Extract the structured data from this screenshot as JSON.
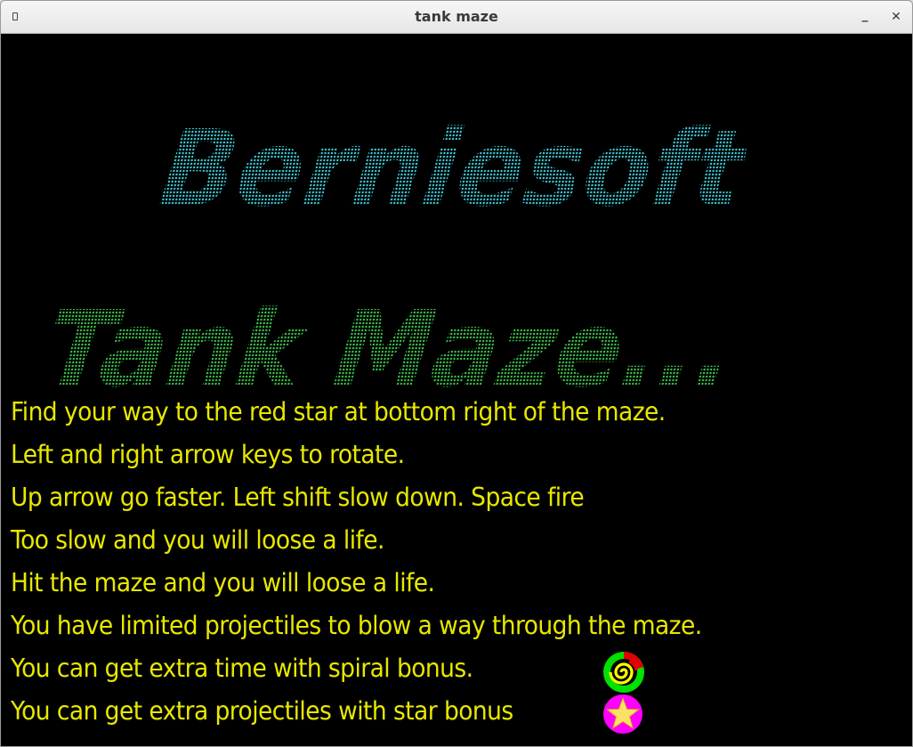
{
  "window": {
    "title": "tank maze"
  },
  "splash": {
    "company_logo": "Berniesoft",
    "game_logo": "Tank Maze...",
    "logo_colors": {
      "company": "#3fcad6",
      "game": "#3ec24e"
    },
    "text_color": "#e8e800",
    "instructions": [
      "Find your way to the red star at bottom right of the maze.",
      "Left and right arrow keys to rotate.",
      "Up arrow go faster. Left shift slow down. Space fire",
      "Too slow and you will loose a life.",
      "Hit the maze and you will loose a life.",
      "You have limited projectiles to blow a way through the maze.",
      "You can get extra time with spiral bonus.",
      "You can get extra projectiles with star bonus"
    ],
    "bonus_icons": {
      "spiral": {
        "icon": "spiral-bonus-icon",
        "colors": [
          "#00e000",
          "#e00000",
          "#ffff00"
        ]
      },
      "star": {
        "icon": "star-bonus-icon",
        "colors": [
          "#ff00ff",
          "#ffe066"
        ]
      }
    }
  }
}
